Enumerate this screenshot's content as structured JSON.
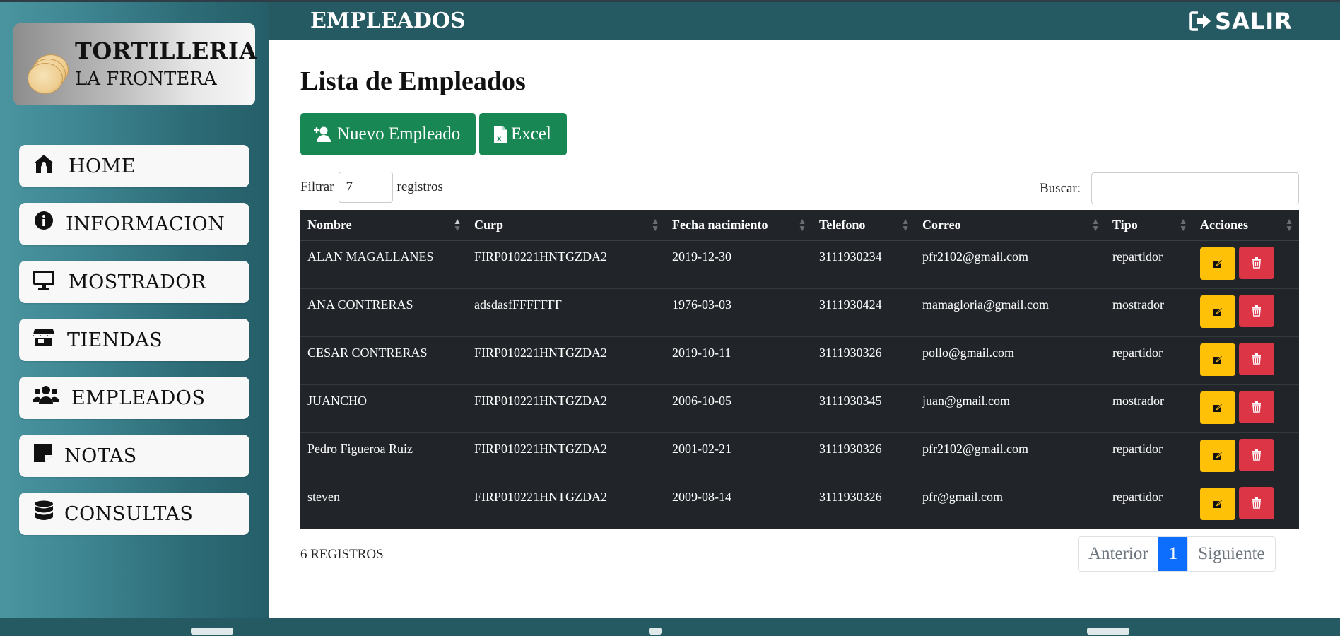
{
  "brand": {
    "title": "TORTILLERIA",
    "subtitle": "LA FRONTERA"
  },
  "header": {
    "title": "EMPLEADOS",
    "logout_label": "SALIR"
  },
  "sidebar": {
    "items": [
      {
        "label": "HOME",
        "icon": "home-icon"
      },
      {
        "label": "INFORMACION",
        "icon": "info-icon"
      },
      {
        "label": "MOSTRADOR",
        "icon": "monitor-icon"
      },
      {
        "label": "TIENDAS",
        "icon": "store-icon"
      },
      {
        "label": "EMPLEADOS",
        "icon": "users-icon"
      },
      {
        "label": "NOTAS",
        "icon": "note-icon"
      },
      {
        "label": "CONSULTAS",
        "icon": "database-icon"
      }
    ]
  },
  "main": {
    "title": "Lista de Empleados",
    "new_button": "Nuevo Empleado",
    "excel_button": "Excel",
    "filter_label": "Filtrar",
    "filter_value": "7",
    "filter_suffix": "registros",
    "search_label": "Buscar:",
    "search_value": "",
    "columns": [
      "Nombre",
      "Curp",
      "Fecha nacimiento",
      "Telefono",
      "Correo",
      "Tipo",
      "Acciones"
    ],
    "rows": [
      [
        "ALAN MAGALLANES",
        "FIRP010221HNTGZDA2",
        "2019-12-30",
        "3111930234",
        "pfr2102@gmail.com",
        "repartidor"
      ],
      [
        "ANA CONTRERAS",
        "adsdasfFFFFFFF",
        "1976-03-03",
        "3111930424",
        "mamagloria@gmail.com",
        "mostrador"
      ],
      [
        "CESAR CONTRERAS",
        "FIRP010221HNTGZDA2",
        "2019-10-11",
        "3111930326",
        "pollo@gmail.com",
        "repartidor"
      ],
      [
        "JUANCHO",
        "FIRP010221HNTGZDA2",
        "2006-10-05",
        "3111930345",
        "juan@gmail.com",
        "mostrador"
      ],
      [
        "Pedro Figueroa Ruiz",
        "FIRP010221HNTGZDA2",
        "2001-02-21",
        "3111930326",
        "pfr2102@gmail.com",
        "repartidor"
      ],
      [
        "steven",
        "FIRP010221HNTGZDA2",
        "2009-08-14",
        "3111930326",
        "pfr@gmail.com",
        "repartidor"
      ]
    ],
    "record_count": "6 REGISTROS",
    "pager": {
      "prev": "Anterior",
      "current": "1",
      "next": "Siguiente"
    }
  },
  "colors": {
    "teal": "#255a63",
    "green": "#198754",
    "warning": "#ffc107",
    "danger": "#dc3545",
    "primary": "#0d6efd",
    "table_dark": "#212529"
  }
}
